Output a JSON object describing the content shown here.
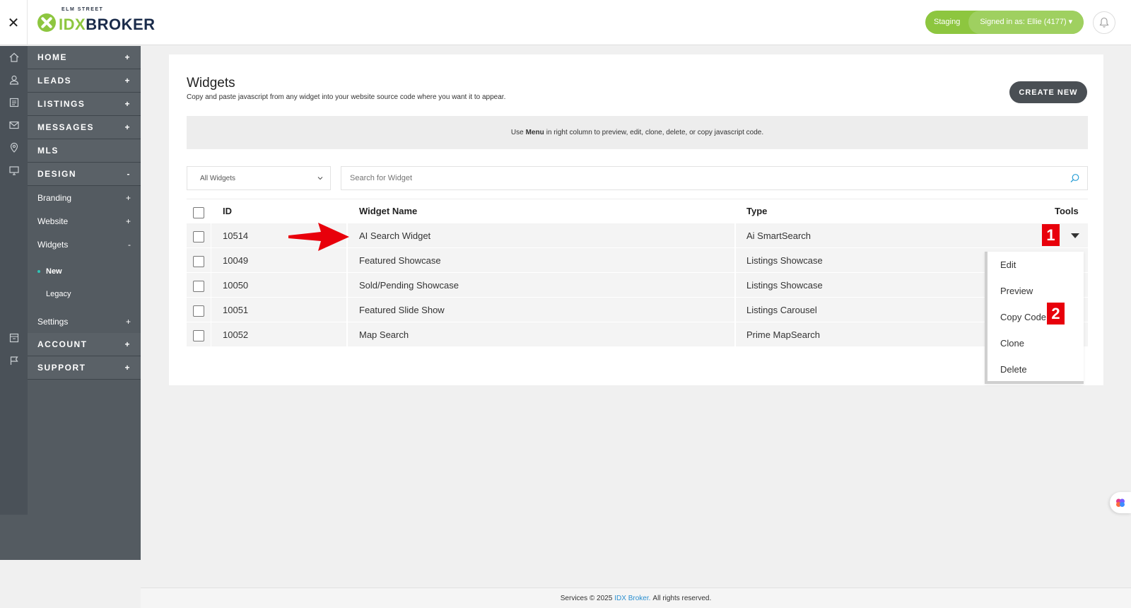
{
  "topbar": {
    "close_symbol": "✕",
    "logo_small": "ELM STREET",
    "logo_idx": "IDX",
    "logo_broker": "BROKER",
    "env_label": "Staging",
    "signed_in": "Signed in as: Ellie (4177)",
    "signed_in_caret": "▾"
  },
  "sidebar": {
    "main_items": [
      {
        "label": "HOME",
        "sign": "+"
      },
      {
        "label": "LEADS",
        "sign": "+"
      },
      {
        "label": "LISTINGS",
        "sign": "+"
      },
      {
        "label": "MESSAGES",
        "sign": "+"
      },
      {
        "label": "MLS",
        "sign": ""
      },
      {
        "label": "DESIGN",
        "sign": "-"
      }
    ],
    "design_sub": [
      {
        "label": "Branding",
        "sign": "+"
      },
      {
        "label": "Website",
        "sign": "+"
      },
      {
        "label": "Widgets",
        "sign": "-"
      }
    ],
    "widgets_sub": [
      {
        "label": "New",
        "active": true
      },
      {
        "label": "Legacy",
        "active": false
      }
    ],
    "settings": {
      "label": "Settings",
      "sign": "+"
    },
    "bottom_items": [
      {
        "label": "ACCOUNT",
        "sign": "+"
      },
      {
        "label": "SUPPORT",
        "sign": "+"
      }
    ]
  },
  "page": {
    "title": "Widgets",
    "subtitle": "Copy and paste javascript from any widget into your website source code where you want it to appear.",
    "create_button": "CREATE NEW",
    "info_prefix": "Use",
    "info_bold": "Menu",
    "info_suffix": "in right column to preview, edit, clone, delete, or copy javascript code.",
    "filter_value": "All Widgets",
    "search_placeholder": "Search for Widget"
  },
  "table": {
    "headers": {
      "id": "ID",
      "name": "Widget Name",
      "type": "Type",
      "tools": "Tools"
    },
    "rows": [
      {
        "id": "10514",
        "name": "AI Search Widget",
        "type": "Ai SmartSearch"
      },
      {
        "id": "10049",
        "name": "Featured Showcase",
        "type": "Listings Showcase"
      },
      {
        "id": "10050",
        "name": "Sold/Pending Showcase",
        "type": "Listings Showcase"
      },
      {
        "id": "10051",
        "name": "Featured Slide Show",
        "type": "Listings Carousel"
      },
      {
        "id": "10052",
        "name": "Map Search",
        "type": "Prime MapSearch"
      }
    ]
  },
  "dropdown": {
    "items": [
      "Edit",
      "Preview",
      "Copy Code",
      "Clone",
      "Delete"
    ]
  },
  "annotations": {
    "badge1": "1",
    "badge2": "2",
    "badge_color": "#e8000b",
    "arrow_color": "#e8000b"
  },
  "footer": {
    "prefix": "Services © 2025",
    "link": "IDX Broker.",
    "suffix": "All rights reserved."
  },
  "colors": {
    "brand_green": "#8dc63f",
    "sidebar": "#545b61",
    "rail": "#4a5158",
    "link_blue": "#2a8fd0"
  }
}
